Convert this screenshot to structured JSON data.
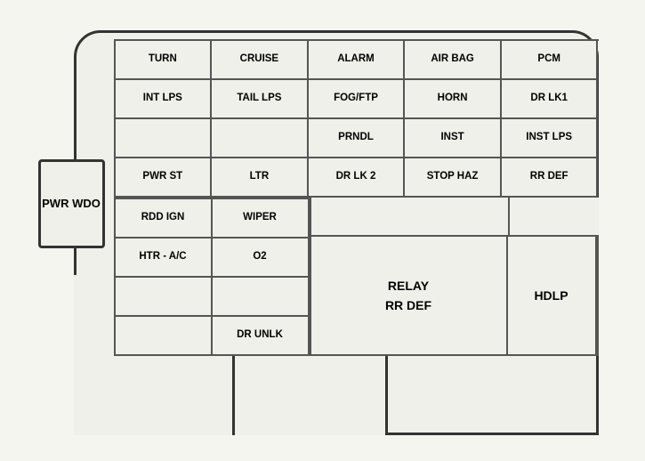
{
  "pwr_wdo": "PWR\nWDO",
  "top_grid": [
    [
      "TURN",
      "CRUISE",
      "ALARM",
      "AIR BAG",
      "PCM"
    ],
    [
      "INT LPS",
      "TAIL LPS",
      "FOG/FTP",
      "HORN",
      "DR LK1"
    ],
    [
      "",
      "",
      "PRNDL",
      "INST",
      "INST LPS"
    ],
    [
      "PWR ST",
      "LTR",
      "DR LK 2",
      "STOP HAZ",
      "RR DEF"
    ]
  ],
  "bottom_left": [
    [
      "RDD IGN",
      "WIPER"
    ],
    [
      "HTR - A/C",
      "O2"
    ],
    [
      "",
      ""
    ],
    [
      "",
      "DR UNLK"
    ]
  ],
  "relay_label": "RELAY\nRR DEF",
  "hdlp_label": "HDLP"
}
